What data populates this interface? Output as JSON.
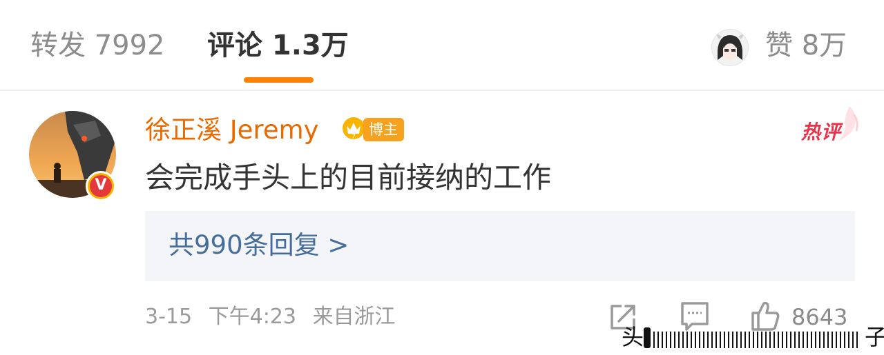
{
  "tabs": {
    "repost": "转发 7992",
    "comments": "评论 1.3万",
    "likes": "赞 8万"
  },
  "comment": {
    "username": "徐正溪 Jeremy",
    "role_badge": "博主",
    "hot_label": "热评",
    "text": "会完成手头上的目前接纳的工作",
    "replies_link": "共990条回复 >",
    "date": "3-15",
    "time": "下午4:23",
    "location": "来自浙江",
    "like_count": "8643"
  },
  "watermark": {
    "left_char": "头",
    "right_char": "子"
  },
  "icons": {
    "verified": "verified-v-icon",
    "crown": "crown-icon",
    "share": "share-icon",
    "comment": "comment-icon",
    "like": "thumbs-up-icon"
  },
  "colors": {
    "accent_orange": "#ff8200",
    "username_orange": "#e86a00",
    "badge_orange": "#f7a21e",
    "link_blue": "#456d9c",
    "hot_red": "#e8344a"
  }
}
